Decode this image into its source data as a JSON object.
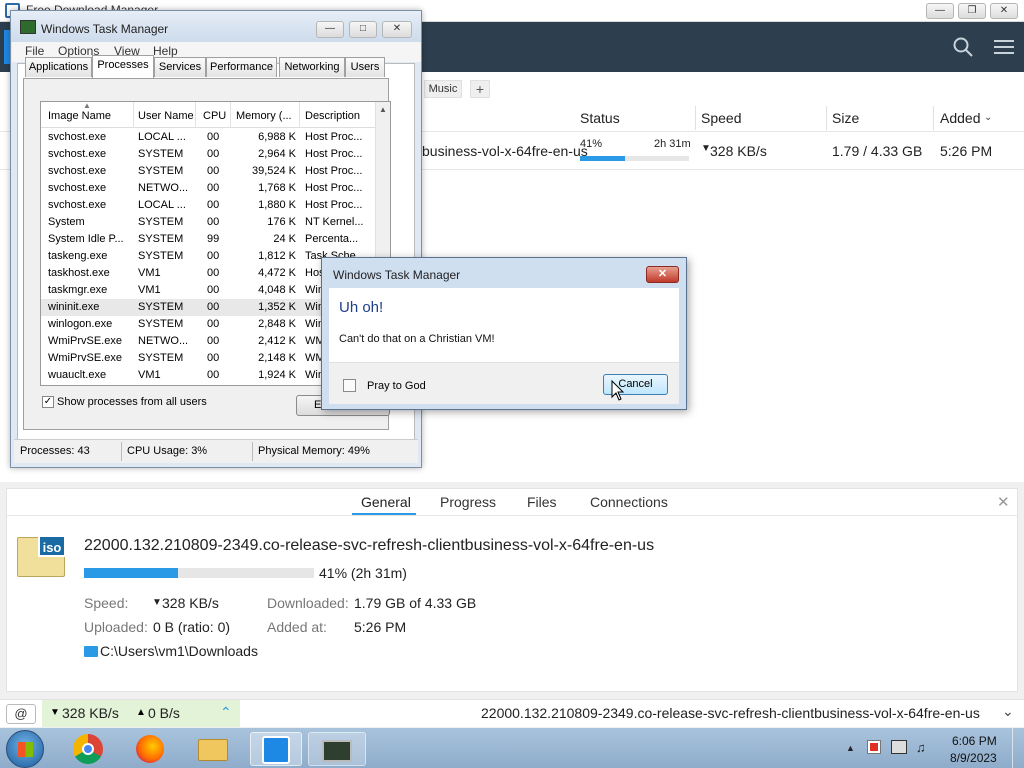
{
  "fdm": {
    "title": "Free Download Manager",
    "tabs": {
      "music": "Music",
      "add": "+"
    },
    "columns": {
      "status": "Status",
      "speed": "Speed",
      "size": "Size",
      "added": "Added"
    },
    "row": {
      "name": "business-vol-x-64fre-en-us",
      "percent": "41%",
      "eta": "2h 31m",
      "progress": 0.41,
      "speed": "328 KB/s",
      "size": "1.79 / 4.33 GB",
      "added": "5:26 PM"
    },
    "detail": {
      "tabs": [
        "General",
        "Progress",
        "Files",
        "Connections"
      ],
      "icon_label": "iso",
      "filename": "22000.132.210809-2349.co-release-svc-refresh-clientbusiness-vol-x-64fre-en-us",
      "progress_text": "41% (2h 31m)",
      "progress": 0.41,
      "speed_label": "Speed:",
      "speed_value": "328 KB/s",
      "downloaded_label": "Downloaded:",
      "downloaded_value": "1.79 GB of 4.33 GB",
      "uploaded_label": "Uploaded:",
      "uploaded_value": "0 B (ratio: 0)",
      "added_label": "Added at:",
      "added_value": "5:26 PM",
      "path": "C:\\Users\\vm1\\Downloads"
    },
    "status": {
      "down": "328 KB/s",
      "up": "0 B/s",
      "current": "22000.132.210809-2349.co-release-svc-refresh-clientbusiness-vol-x-64fre-en-us"
    }
  },
  "taskmgr": {
    "title": "Windows Task Manager",
    "menu": [
      "File",
      "Options",
      "View",
      "Help"
    ],
    "tabs": [
      "Applications",
      "Processes",
      "Services",
      "Performance",
      "Networking",
      "Users"
    ],
    "headers": [
      "Image Name",
      "User Name",
      "CPU",
      "Memory (...",
      "Description"
    ],
    "rows": [
      [
        "svchost.exe",
        "LOCAL ...",
        "00",
        "6,988 K",
        "Host Proc..."
      ],
      [
        "svchost.exe",
        "SYSTEM",
        "00",
        "2,964 K",
        "Host Proc..."
      ],
      [
        "svchost.exe",
        "SYSTEM",
        "00",
        "39,524 K",
        "Host Proc..."
      ],
      [
        "svchost.exe",
        "NETWO...",
        "00",
        "1,768 K",
        "Host Proc..."
      ],
      [
        "svchost.exe",
        "LOCAL ...",
        "00",
        "1,880 K",
        "Host Proc..."
      ],
      [
        "System",
        "SYSTEM",
        "00",
        "176 K",
        "NT Kernel..."
      ],
      [
        "System Idle P...",
        "SYSTEM",
        "99",
        "24 K",
        "Percenta..."
      ],
      [
        "taskeng.exe",
        "SYSTEM",
        "00",
        "1,812 K",
        "Task Sche..."
      ],
      [
        "taskhost.exe",
        "VM1",
        "00",
        "4,472 K",
        "Host"
      ],
      [
        "taskmgr.exe",
        "VM1",
        "00",
        "4,048 K",
        "Win"
      ],
      [
        "wininit.exe",
        "SYSTEM",
        "00",
        "1,352 K",
        "Win"
      ],
      [
        "winlogon.exe",
        "SYSTEM",
        "00",
        "2,848 K",
        "Win"
      ],
      [
        "WmiPrvSE.exe",
        "NETWO...",
        "00",
        "2,412 K",
        "WM"
      ],
      [
        "WmiPrvSE.exe",
        "SYSTEM",
        "00",
        "2,148 K",
        "WM"
      ],
      [
        "wuauclt.exe",
        "VM1",
        "00",
        "1,924 K",
        "Win"
      ]
    ],
    "show_all": "Show processes from all users",
    "end_btn": "E",
    "status_processes": "Processes: 43",
    "status_cpu": "CPU Usage: 3%",
    "status_mem": "Physical Memory: 49%"
  },
  "dialog": {
    "title": "Windows Task Manager",
    "heading": "Uh oh!",
    "message": "Can't do that on a Christian VM!",
    "checkbox_label": "Pray to God",
    "cancel": "Cancel"
  },
  "taskbar": {
    "time": "6:06 PM",
    "date": "8/9/2023"
  }
}
